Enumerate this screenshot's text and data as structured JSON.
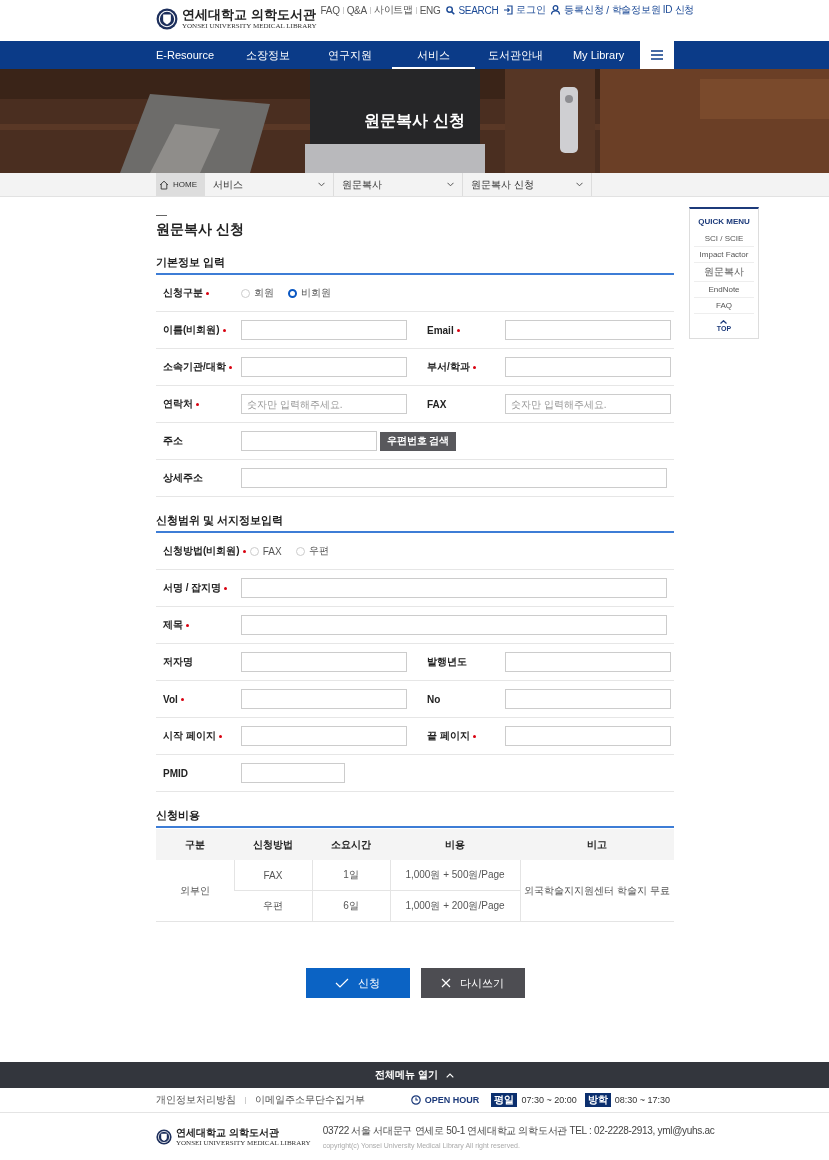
{
  "header": {
    "logo_title": "연세대학교 의학도서관",
    "logo_subtitle": "YONSEI UNIVERSITY MEDICAL LIBRARY",
    "top_links": [
      "FAQ",
      "Q&A",
      "사이트맵",
      "ENG"
    ],
    "search": "SEARCH",
    "login": "로그인",
    "register": "등록신청",
    "separator": "/",
    "id_request": "학술정보원 ID 신청"
  },
  "nav": [
    {
      "label": "E-Resource",
      "selected": false
    },
    {
      "label": "소장정보",
      "selected": false
    },
    {
      "label": "연구지원",
      "selected": false
    },
    {
      "label": "서비스",
      "selected": true
    },
    {
      "label": "도서관안내",
      "selected": false
    },
    {
      "label": "My Library",
      "selected": false
    }
  ],
  "hero": {
    "title": "원문복사 신청"
  },
  "breadcrumb": {
    "home": "HOME",
    "items": [
      "서비스",
      "원문복사",
      "원문복사 신청"
    ]
  },
  "page_title": "원문복사 신청",
  "sections": [
    {
      "title": "기본정보 입력",
      "rows": [
        {
          "kind": "radio",
          "label": "신청구분",
          "required": true,
          "options": [
            {
              "label": "회원",
              "selected": false
            },
            {
              "label": "비회원",
              "selected": true
            }
          ]
        },
        {
          "kind": "fields",
          "fields": [
            {
              "label": "이름(비회원)",
              "required": true
            },
            {
              "label": "Email",
              "required": true
            }
          ]
        },
        {
          "kind": "fields",
          "fields": [
            {
              "label": "소속기관/대학",
              "required": true
            },
            {
              "label": "부서/학과",
              "required": true
            }
          ]
        },
        {
          "kind": "fields",
          "fields": [
            {
              "label": "연락처",
              "required": true,
              "placeholder": "숫자만 입력해주세요."
            },
            {
              "label": "FAX",
              "required": false,
              "placeholder": "숫자만 입력해주세요."
            }
          ]
        },
        {
          "kind": "address",
          "label": "주소",
          "required": false,
          "button": "우편번호 검색"
        },
        {
          "kind": "wide",
          "label": "상세주소",
          "required": false
        }
      ]
    },
    {
      "title": "신청범위 및 서지정보입력",
      "rows": [
        {
          "kind": "radio",
          "label": "신청방법(비회원)",
          "required": true,
          "options": [
            {
              "label": "FAX",
              "selected": false
            },
            {
              "label": "우편",
              "selected": false
            }
          ]
        },
        {
          "kind": "wide",
          "label": "서명 / 잡지명",
          "required": true
        },
        {
          "kind": "wide",
          "label": "제목",
          "required": true
        },
        {
          "kind": "fields",
          "fields": [
            {
              "label": "저자명",
              "required": false
            },
            {
              "label": "발행년도",
              "required": false
            }
          ]
        },
        {
          "kind": "fields",
          "fields": [
            {
              "label": "Vol",
              "required": true
            },
            {
              "label": "No",
              "required": false
            }
          ]
        },
        {
          "kind": "fields",
          "fields": [
            {
              "label": "시작 페이지",
              "required": true
            },
            {
              "label": "끝 페이지",
              "required": true
            }
          ]
        },
        {
          "kind": "short",
          "label": "PMID",
          "required": false
        }
      ]
    }
  ],
  "fee": {
    "title": "신청비용",
    "columns": [
      "구분",
      "신청방법",
      "소요시간",
      "비용",
      "비고"
    ],
    "group": "외부인",
    "note": "외국학술지지원센터 학술지 무료",
    "rows": [
      {
        "method": "FAX",
        "time": "1일",
        "cost": "1,000원 + 500원/Page"
      },
      {
        "method": "우편",
        "time": "6일",
        "cost": "1,000원 + 200원/Page"
      }
    ]
  },
  "buttons": {
    "submit": "신청",
    "reset": "다시쓰기"
  },
  "quick_menu": {
    "title": "QUICK MENU",
    "items": [
      "SCI / SCIE",
      "Impact Factor",
      "원문복사",
      "EndNote",
      "FAQ"
    ],
    "top": "TOP"
  },
  "footer": {
    "menu_toggle": "전체메뉴 열기",
    "links": [
      "개인정보처리방침",
      "이메일주소무단수집거부"
    ],
    "open_hour": "OPEN HOUR",
    "hours": [
      {
        "badge": "평일",
        "time": "07:30 ~ 20:00"
      },
      {
        "badge": "방학",
        "time": "08:30 ~ 17:30"
      }
    ],
    "address": "03722 서울 서대문구 연세로 50-1 연세대학교 의학도서관  TEL : 02-2228-2913, yml@yuhs.ac",
    "copyright": "copyright(c) Yonsei University Medical Library All right reserved.",
    "logo_title": "연세대학교 의학도서관",
    "logo_subtitle": "YONSEI UNIVERSITY MEDICAL LIBRARY"
  }
}
